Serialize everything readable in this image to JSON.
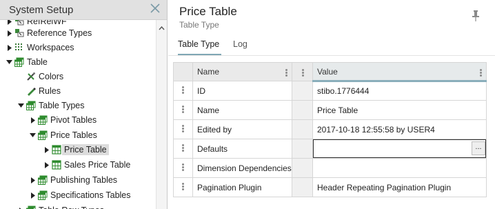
{
  "left": {
    "title": "System Setup",
    "tree": [
      {
        "label": "RefRelWF",
        "indent": 0,
        "toggle": "right",
        "icon": "ref-icon",
        "partial": true
      },
      {
        "label": "Reference Types",
        "indent": 0,
        "toggle": "right",
        "icon": "reference-types-icon"
      },
      {
        "label": "Workspaces",
        "indent": 0,
        "toggle": "right",
        "icon": "workspaces-icon"
      },
      {
        "label": "Table",
        "indent": 0,
        "toggle": "down",
        "icon": "table-green-icon"
      },
      {
        "label": "Colors",
        "indent": 1,
        "toggle": "none",
        "icon": "colors-icon"
      },
      {
        "label": "Rules",
        "indent": 1,
        "toggle": "none",
        "icon": "rules-icon"
      },
      {
        "label": "Table Types",
        "indent": 1,
        "toggle": "down",
        "icon": "table-types-icon"
      },
      {
        "label": "Pivot Tables",
        "indent": 2,
        "toggle": "right",
        "icon": "table-types-icon"
      },
      {
        "label": "Price Tables",
        "indent": 2,
        "toggle": "down",
        "icon": "table-types-icon"
      },
      {
        "label": "Price Table",
        "indent": 3,
        "toggle": "right",
        "icon": "table-icon",
        "selected": true
      },
      {
        "label": "Sales Price Table",
        "indent": 3,
        "toggle": "right",
        "icon": "table-icon"
      },
      {
        "label": "Publishing Tables",
        "indent": 2,
        "toggle": "right",
        "icon": "table-types-icon"
      },
      {
        "label": "Specifications Tables",
        "indent": 2,
        "toggle": "right",
        "icon": "table-types-icon"
      },
      {
        "label": "Table Row Types",
        "indent": 1,
        "toggle": "right",
        "icon": "table-types-icon",
        "partial": true
      }
    ]
  },
  "right": {
    "title": "Price Table",
    "subtitle": "Table Type",
    "tabs": [
      "Table Type",
      "Log"
    ],
    "active_tab": 0,
    "grid": {
      "headers": {
        "name": "Name",
        "value": "Value"
      },
      "rows": [
        {
          "name": "ID",
          "value": "stibo.1776444"
        },
        {
          "name": "Name",
          "value": "Price Table"
        },
        {
          "name": "Edited by",
          "value": "2017-10-18 12:55:58 by USER4"
        },
        {
          "name": "Defaults",
          "value": "",
          "editing": true,
          "button": "..."
        },
        {
          "name": "Dimension Dependencies",
          "value": ""
        },
        {
          "name": "Pagination Plugin",
          "value": "Header Repeating Pagination Plugin"
        }
      ]
    }
  },
  "colors": {
    "header_bg": "#e1e1e1",
    "tab_underline": "#7fa7b4",
    "icon_green": "#2e8b2e"
  }
}
